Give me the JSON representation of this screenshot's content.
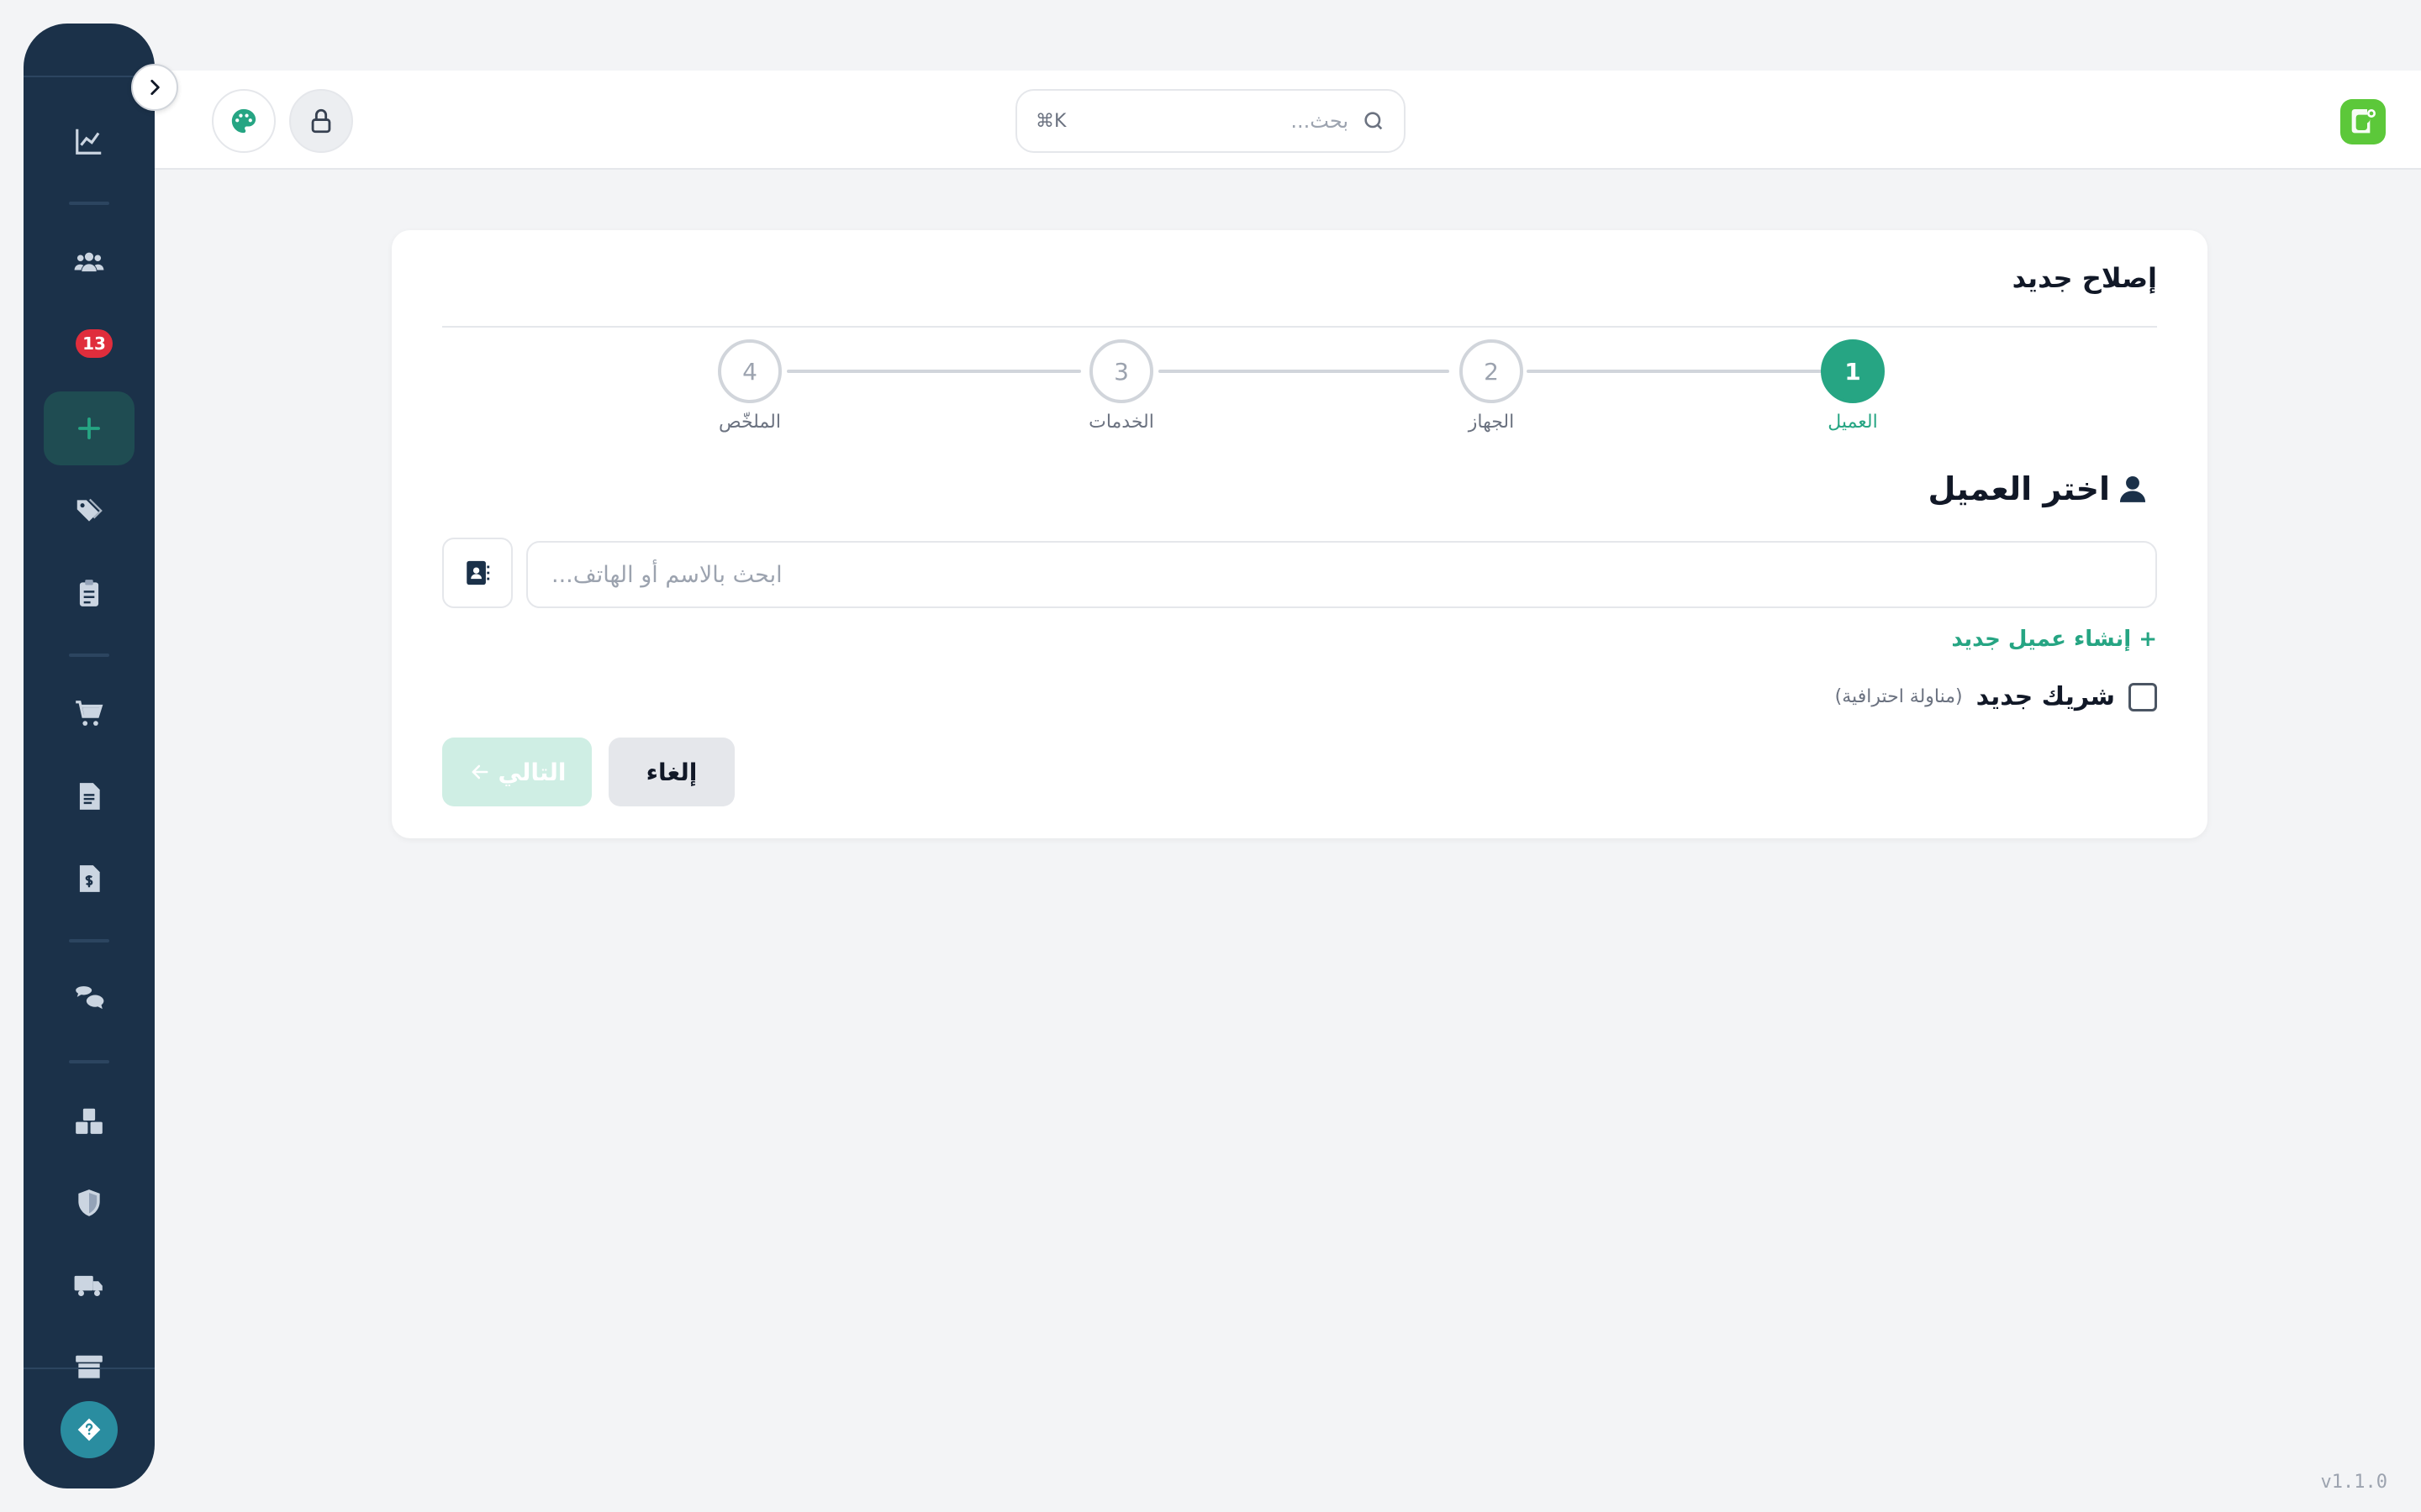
{
  "header": {
    "search_placeholder": "بحث...",
    "search_shortcut": "⌘K"
  },
  "card": {
    "title": "إصلاح جديد",
    "steps": [
      {
        "number": "1",
        "label": "العميل",
        "active": true
      },
      {
        "number": "2",
        "label": "الجهاز",
        "active": false
      },
      {
        "number": "3",
        "label": "الخدمات",
        "active": false
      },
      {
        "number": "4",
        "label": "الملخّص",
        "active": false
      }
    ],
    "section_title": "اختر العميل",
    "client_search_placeholder": "ابحث بالاسم أو الهاتف...",
    "new_client_link": "+ إنشاء عميل جديد",
    "new_partner_label": "شريك جديد",
    "new_partner_note": "(مناولة احترافية)",
    "cancel_label": "إلغاء",
    "next_label": "التالي"
  },
  "sidebar": {
    "badge_count": "13"
  },
  "footer": {
    "version": "v1.1.0"
  },
  "colors": {
    "accent": "#26a583",
    "sidebar_bg": "#1b3149",
    "badge": "#e02d3c",
    "logo": "#5cc83a"
  },
  "icons": {
    "sidebar": [
      "chart-line-icon",
      "users-icon",
      "notification-icon",
      "plus-icon",
      "tags-icon",
      "clipboard-icon",
      "cart-icon",
      "document-icon",
      "invoice-icon",
      "chat-icon",
      "boxes-icon",
      "shield-icon",
      "truck-icon",
      "archive-icon",
      "help-icon"
    ]
  }
}
